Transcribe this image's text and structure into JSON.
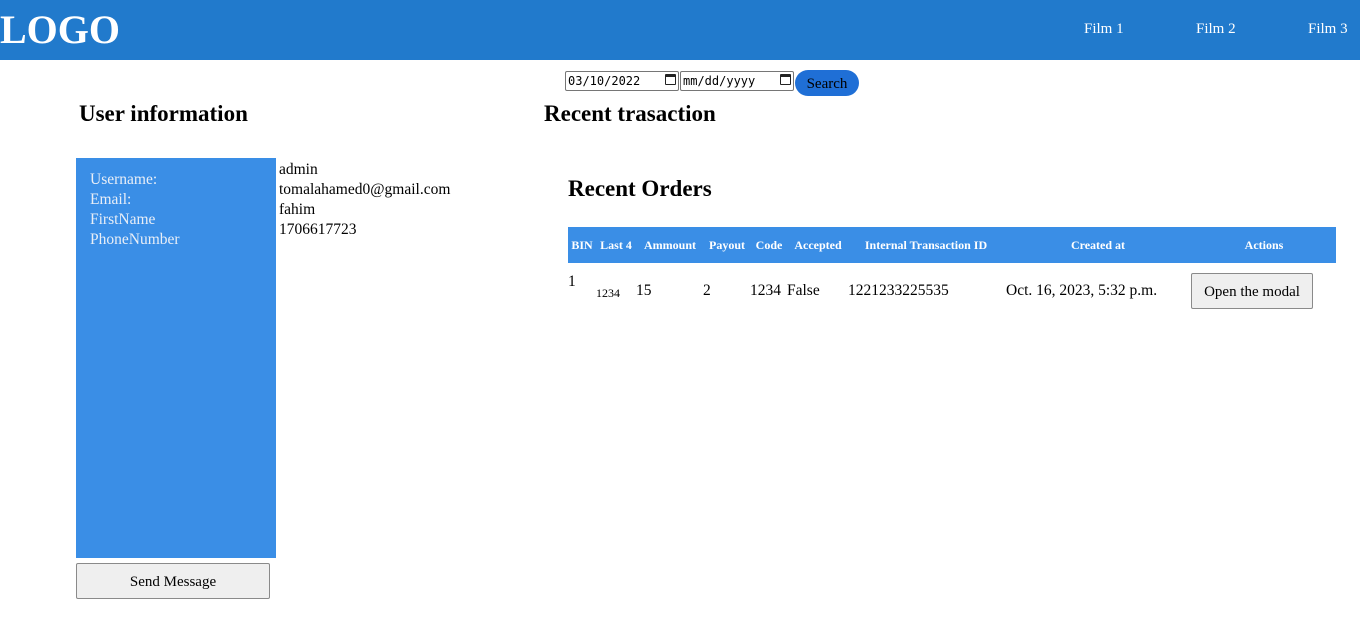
{
  "navbar": {
    "logo": "LOGO",
    "links": [
      "Film 1",
      "Film 2",
      "Film 3"
    ]
  },
  "filter": {
    "start_date": "03/10/2022",
    "end_date_placeholder": "mm/dd/yyyy",
    "search_label": "Search"
  },
  "user_info": {
    "title": "User information",
    "labels": [
      "Username:",
      "Email:",
      "FirstName",
      "PhoneNumber"
    ],
    "values": [
      "admin",
      "tomalahamed0@gmail.com",
      "fahim",
      "1706617723"
    ],
    "send_label": "Send Message"
  },
  "transactions": {
    "title": "Recent trasaction"
  },
  "orders": {
    "title": "Recent Orders",
    "columns": [
      "BIN",
      "Last 4",
      "Ammount",
      "Payout",
      "Code",
      "Accepted",
      "Internal Transaction ID",
      "Created at",
      "Actions"
    ],
    "rows": [
      {
        "bin": "1",
        "last4": "1234",
        "amount": "15",
        "payout": "2",
        "code": "1234",
        "accepted": "False",
        "internal_id": "1221233225535",
        "created_at": "Oct. 16, 2023, 5:32 p.m.",
        "action_label": "Open the modal"
      }
    ]
  },
  "colors": {
    "navbar": "#217acc",
    "panel": "#3a8ee6",
    "search_button": "#1f6fd6"
  }
}
